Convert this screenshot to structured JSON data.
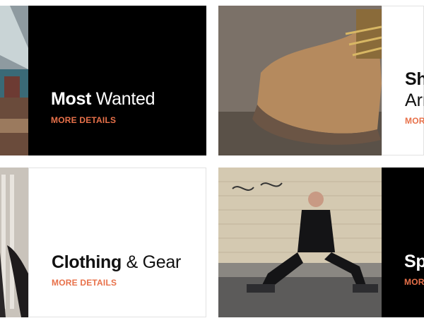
{
  "cards": [
    {
      "title_bold": "Most",
      "title_light": "Wanted",
      "subtitle": "",
      "link": "MORE DETAILS",
      "photo": "fashion-store-photo"
    },
    {
      "title_bold": "Sh",
      "title_light": "",
      "subtitle": "Arr",
      "link": "MORE",
      "photo": "boot-photo"
    },
    {
      "title_bold": "Clothing",
      "title_light": "& Gear",
      "subtitle": "",
      "link": "MORE DETAILS",
      "photo": "tights-photo"
    },
    {
      "title_bold": "Sp",
      "title_light": "",
      "subtitle": "",
      "link": "MORE",
      "photo": "man-sitting-photo"
    }
  ],
  "colors": {
    "accent": "#e8714a",
    "dark_panel": "#000000",
    "light_panel": "#ffffff"
  }
}
